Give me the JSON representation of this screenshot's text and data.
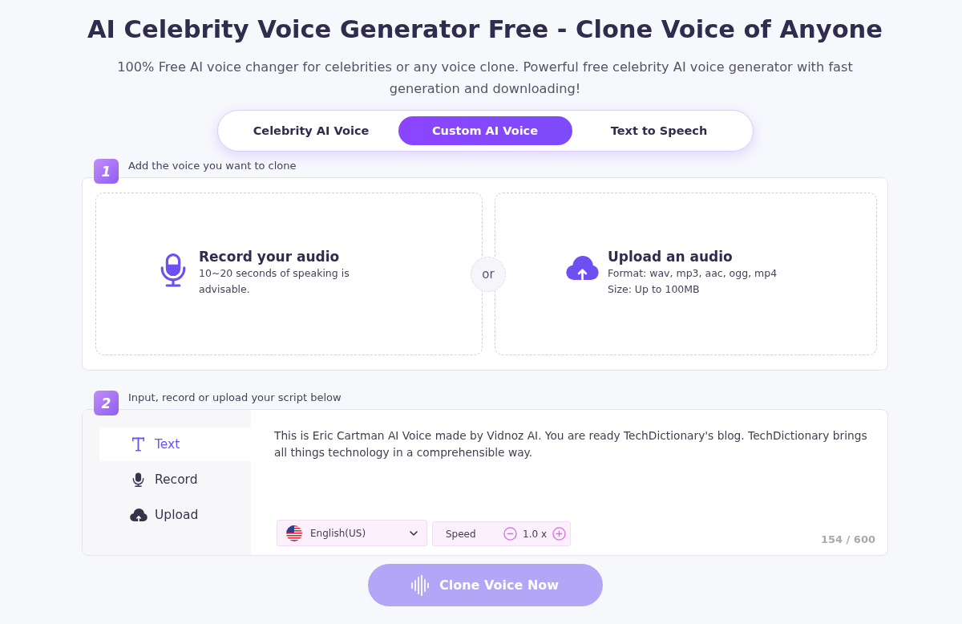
{
  "header": {
    "title": "AI Celebrity Voice Generator Free - Clone Voice of Anyone",
    "subtitle": "100% Free AI voice changer for celebrities or any voice clone. Powerful free celebrity AI voice generator with fast generation and downloading!"
  },
  "tabs": [
    {
      "label": "Celebrity AI Voice",
      "selected": false
    },
    {
      "label": "Custom AI Voice",
      "selected": true
    },
    {
      "label": "Text to Speech",
      "selected": false
    }
  ],
  "step_1": {
    "number": "1",
    "label": "Add the voice you want to clone",
    "options": [
      {
        "kind": "record",
        "title": "Record your audio",
        "lines": [
          "10~20 seconds of speaking is advisable."
        ]
      },
      {
        "kind": "upload",
        "title": "Upload an audio",
        "lines": [
          "Format: wav, mp3, aac, ogg, mp4",
          "Size: Up to 100MB"
        ]
      }
    ],
    "separator": "or"
  },
  "step_2": {
    "number": "2",
    "label": "Input, record or upload your script below",
    "modes": [
      {
        "kind": "text",
        "label": "Text",
        "selected": true
      },
      {
        "kind": "record",
        "label": "Record",
        "selected": false
      },
      {
        "kind": "upload",
        "label": "Upload",
        "selected": false
      }
    ],
    "script": {
      "value": "This is Eric Cartman AI Voice made by Vidnoz AI. You are ready TechDictionary's blog. TechDictionary brings all things technology in a comprehensible way.",
      "counter": "154 / 600"
    },
    "language": {
      "value": "English(US)"
    },
    "speed": {
      "label": "Speed",
      "value": "1.0 x"
    }
  },
  "clone_button": {
    "label": "Clone Voice Now",
    "disabled": true
  }
}
